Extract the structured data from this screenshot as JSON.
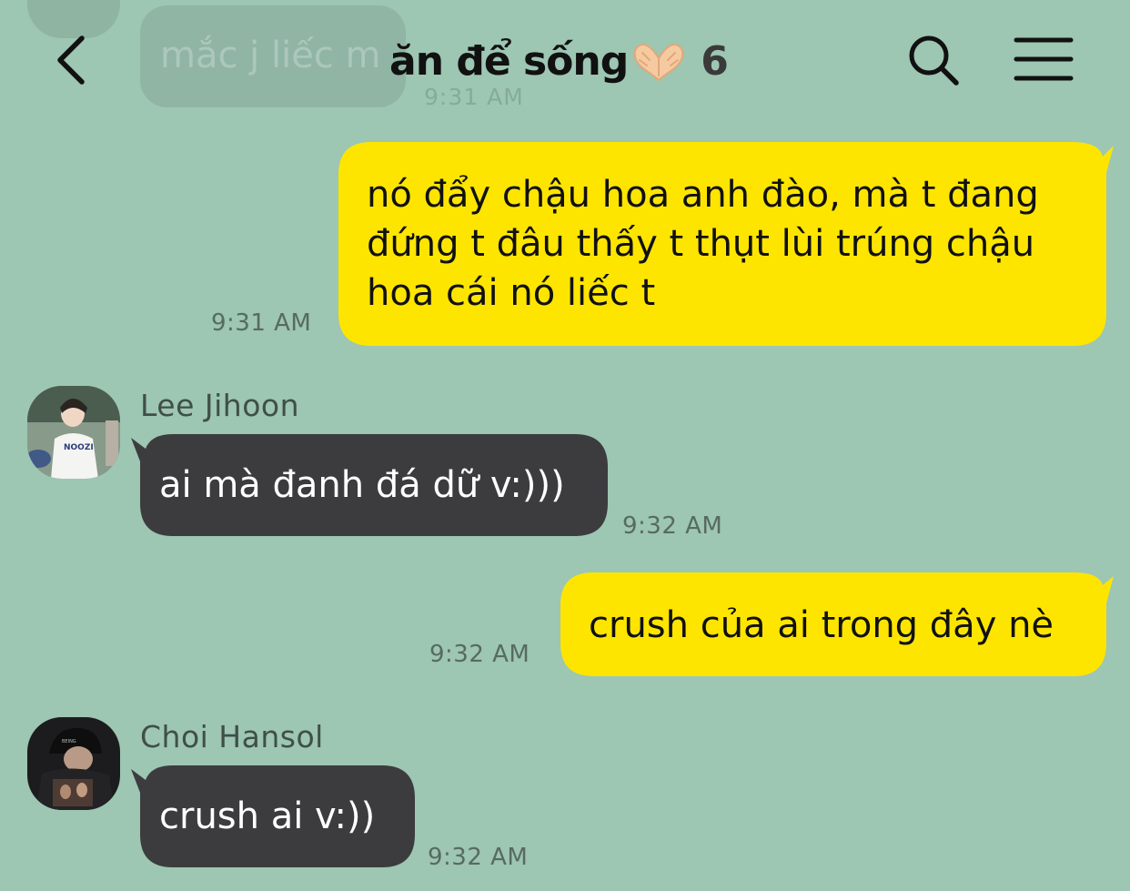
{
  "colors": {
    "background": "#9dc6b3",
    "outgoing_bubble": "#fee500",
    "incoming_bubble": "#3c3c3f",
    "incoming_text": "#ffffff",
    "outgoing_text": "#111111",
    "timestamp": "#576b60",
    "sender_name": "#3f4f48",
    "icon": "#111111"
  },
  "header": {
    "back_icon": "chevron-left-icon",
    "title": "ăn để sống",
    "title_emoji": "heart-hands-emoji",
    "member_count": "6",
    "search_icon": "search-icon",
    "menu_icon": "hamburger-menu-icon"
  },
  "previous_message": {
    "text": "mắc j liếc m",
    "time": "9:31 AM"
  },
  "messages": [
    {
      "direction": "outgoing",
      "text": "nó đẩy chậu hoa anh đào, mà t đang\nđứng t đâu thấy t thụt lùi trúng chậu\nhoa cái nó liếc t",
      "time": "9:31 AM"
    },
    {
      "direction": "incoming",
      "sender": "Lee Jihoon",
      "text": "ai mà đanh đá dữ v:)))",
      "time": "9:32 AM"
    },
    {
      "direction": "outgoing",
      "text": "crush của ai trong đây nè",
      "time": "9:32 AM"
    },
    {
      "direction": "incoming",
      "sender": "Choi Hansol",
      "text": "crush ai v:))",
      "time": "9:32 AM"
    }
  ]
}
